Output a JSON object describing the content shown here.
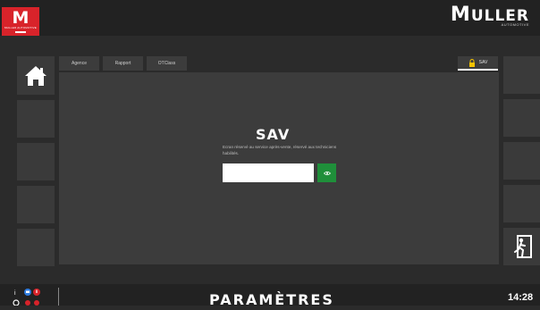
{
  "header": {
    "logo_letter": "M",
    "logo_subtext": "MULLER AUTOMOTIVE",
    "brand_name_first": "M",
    "brand_name_rest": "ULLER",
    "brand_tagline": "AUTOMOTIVE"
  },
  "tabs": [
    {
      "label": "Agence"
    },
    {
      "label": "Rapport"
    },
    {
      "label": "OTClass"
    }
  ],
  "active_tab": {
    "label": "SAV",
    "icon": "lock-icon"
  },
  "main": {
    "title": "SAV",
    "description": "Ecran réservé au service après-vente, réservé aux techniciens habilités.",
    "input_value": "",
    "submit_icon": "eye-icon"
  },
  "footer": {
    "page_title": "PARAMÈTRES",
    "clock": "14:28"
  },
  "colors": {
    "brand_red": "#d8232a",
    "accent_green": "#1f8f3a",
    "status_blue": "#2f7de1",
    "status_red": "#d8232a"
  }
}
